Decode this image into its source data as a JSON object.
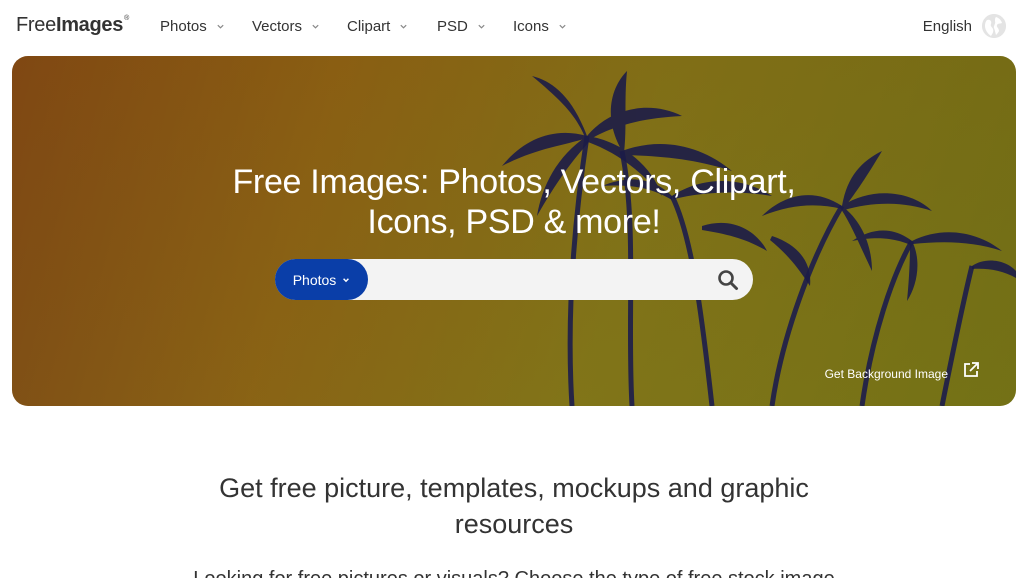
{
  "brand": {
    "logo_light": "Free",
    "logo_bold": "Images",
    "logo_mark": "®"
  },
  "nav": {
    "items": [
      {
        "label": "Photos"
      },
      {
        "label": "Vectors"
      },
      {
        "label": "Clipart"
      },
      {
        "label": "PSD"
      },
      {
        "label": "Icons"
      }
    ],
    "language": "English"
  },
  "hero": {
    "title_line1": "Free Images: Photos, Vectors, Clipart,",
    "title_line2": "Icons, PSD & more!",
    "search_type": "Photos",
    "search_placeholder": "",
    "background_link": "Get Background Image",
    "colors": {
      "button": "#0a3ea8",
      "overlay_start": "#8a4f16",
      "overlay_end": "#7d7b14"
    }
  },
  "content": {
    "heading_line1": "Get free picture, templates, mockups and graphic",
    "heading_line2": "resources",
    "intro": "Looking for free pictures or visuals? Choose the type of free stock image"
  }
}
